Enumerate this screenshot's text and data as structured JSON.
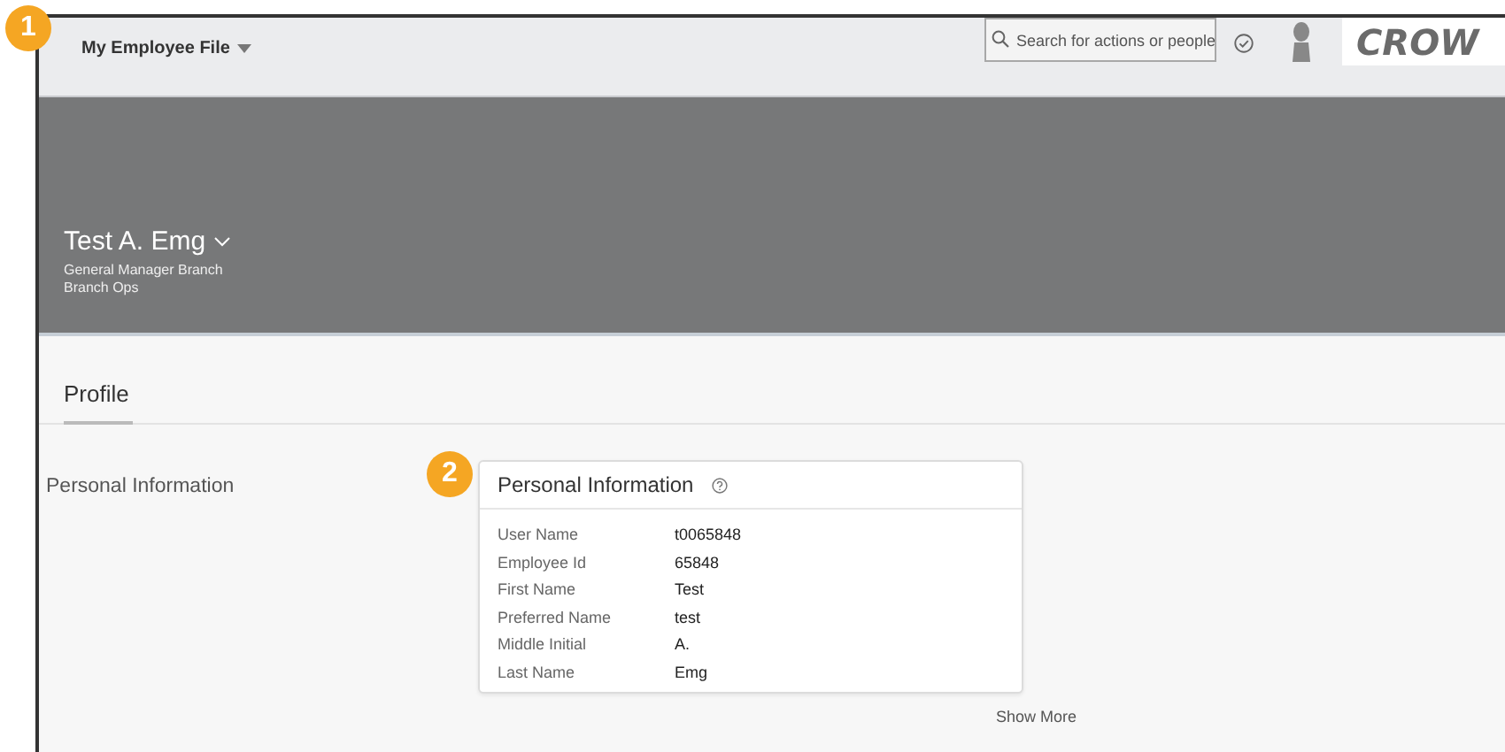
{
  "header": {
    "title": "My Employee File",
    "search": {
      "placeholder": "Search for actions or people"
    },
    "logo": "CROW"
  },
  "banner": {
    "name": "Test A. Emg",
    "lines": [
      "General Manager Branch",
      "Branch Ops"
    ]
  },
  "tabs": [
    {
      "label": "Profile",
      "selected": true
    }
  ],
  "section_label": "Personal Information",
  "card": {
    "title": "Personal Information",
    "rows": [
      {
        "label": "User Name",
        "value": "t0065848"
      },
      {
        "label": "Employee Id",
        "value": "65848"
      },
      {
        "label": "First Name",
        "value": "Test"
      },
      {
        "label": "Preferred Name",
        "value": "test"
      },
      {
        "label": "Middle Initial",
        "value": "A."
      },
      {
        "label": "Last Name",
        "value": "Emg"
      }
    ],
    "show_more": "Show More"
  },
  "callouts": [
    "1",
    "2"
  ]
}
